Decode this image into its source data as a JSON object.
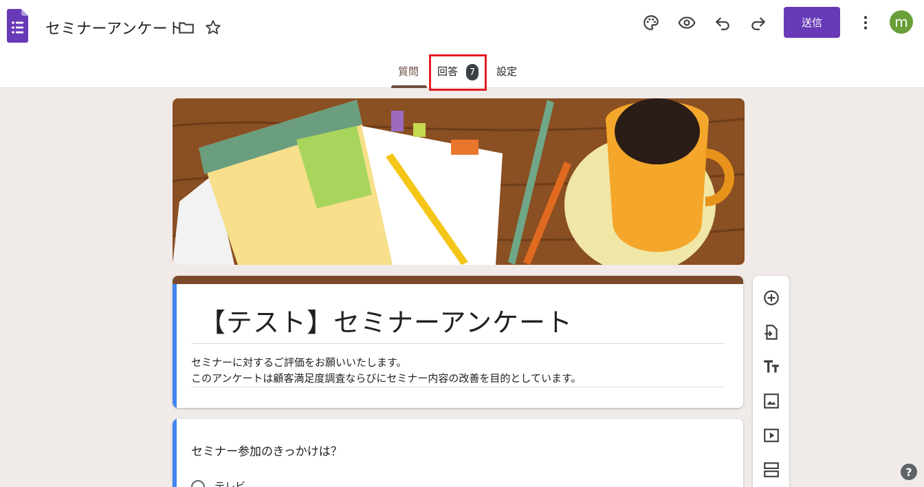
{
  "app": {
    "doc_title": "セミナーアンケート",
    "send_label": "送信",
    "avatar_letter": "m"
  },
  "tabs": [
    {
      "label": "質問",
      "active": true
    },
    {
      "label": "回答",
      "badge": "7"
    },
    {
      "label": "設定"
    }
  ],
  "form": {
    "title": "【テスト】セミナーアンケート",
    "description_line1": "セミナーに対するご評価をお願いいたします。",
    "description_line2": "このアンケートは顧客満足度調査ならびにセミナー内容の改善を目的としています。"
  },
  "question": {
    "title": "セミナー参加のきっかけは？",
    "option1": "テレビ"
  },
  "help_label": "?",
  "colors": {
    "accent": "#673ab7",
    "tab_active": "#6d4c41",
    "title_strip": "#7b4a2a",
    "focus_strip": "#4285f4",
    "highlight": "#e51c23",
    "avatar": "#689f38"
  }
}
